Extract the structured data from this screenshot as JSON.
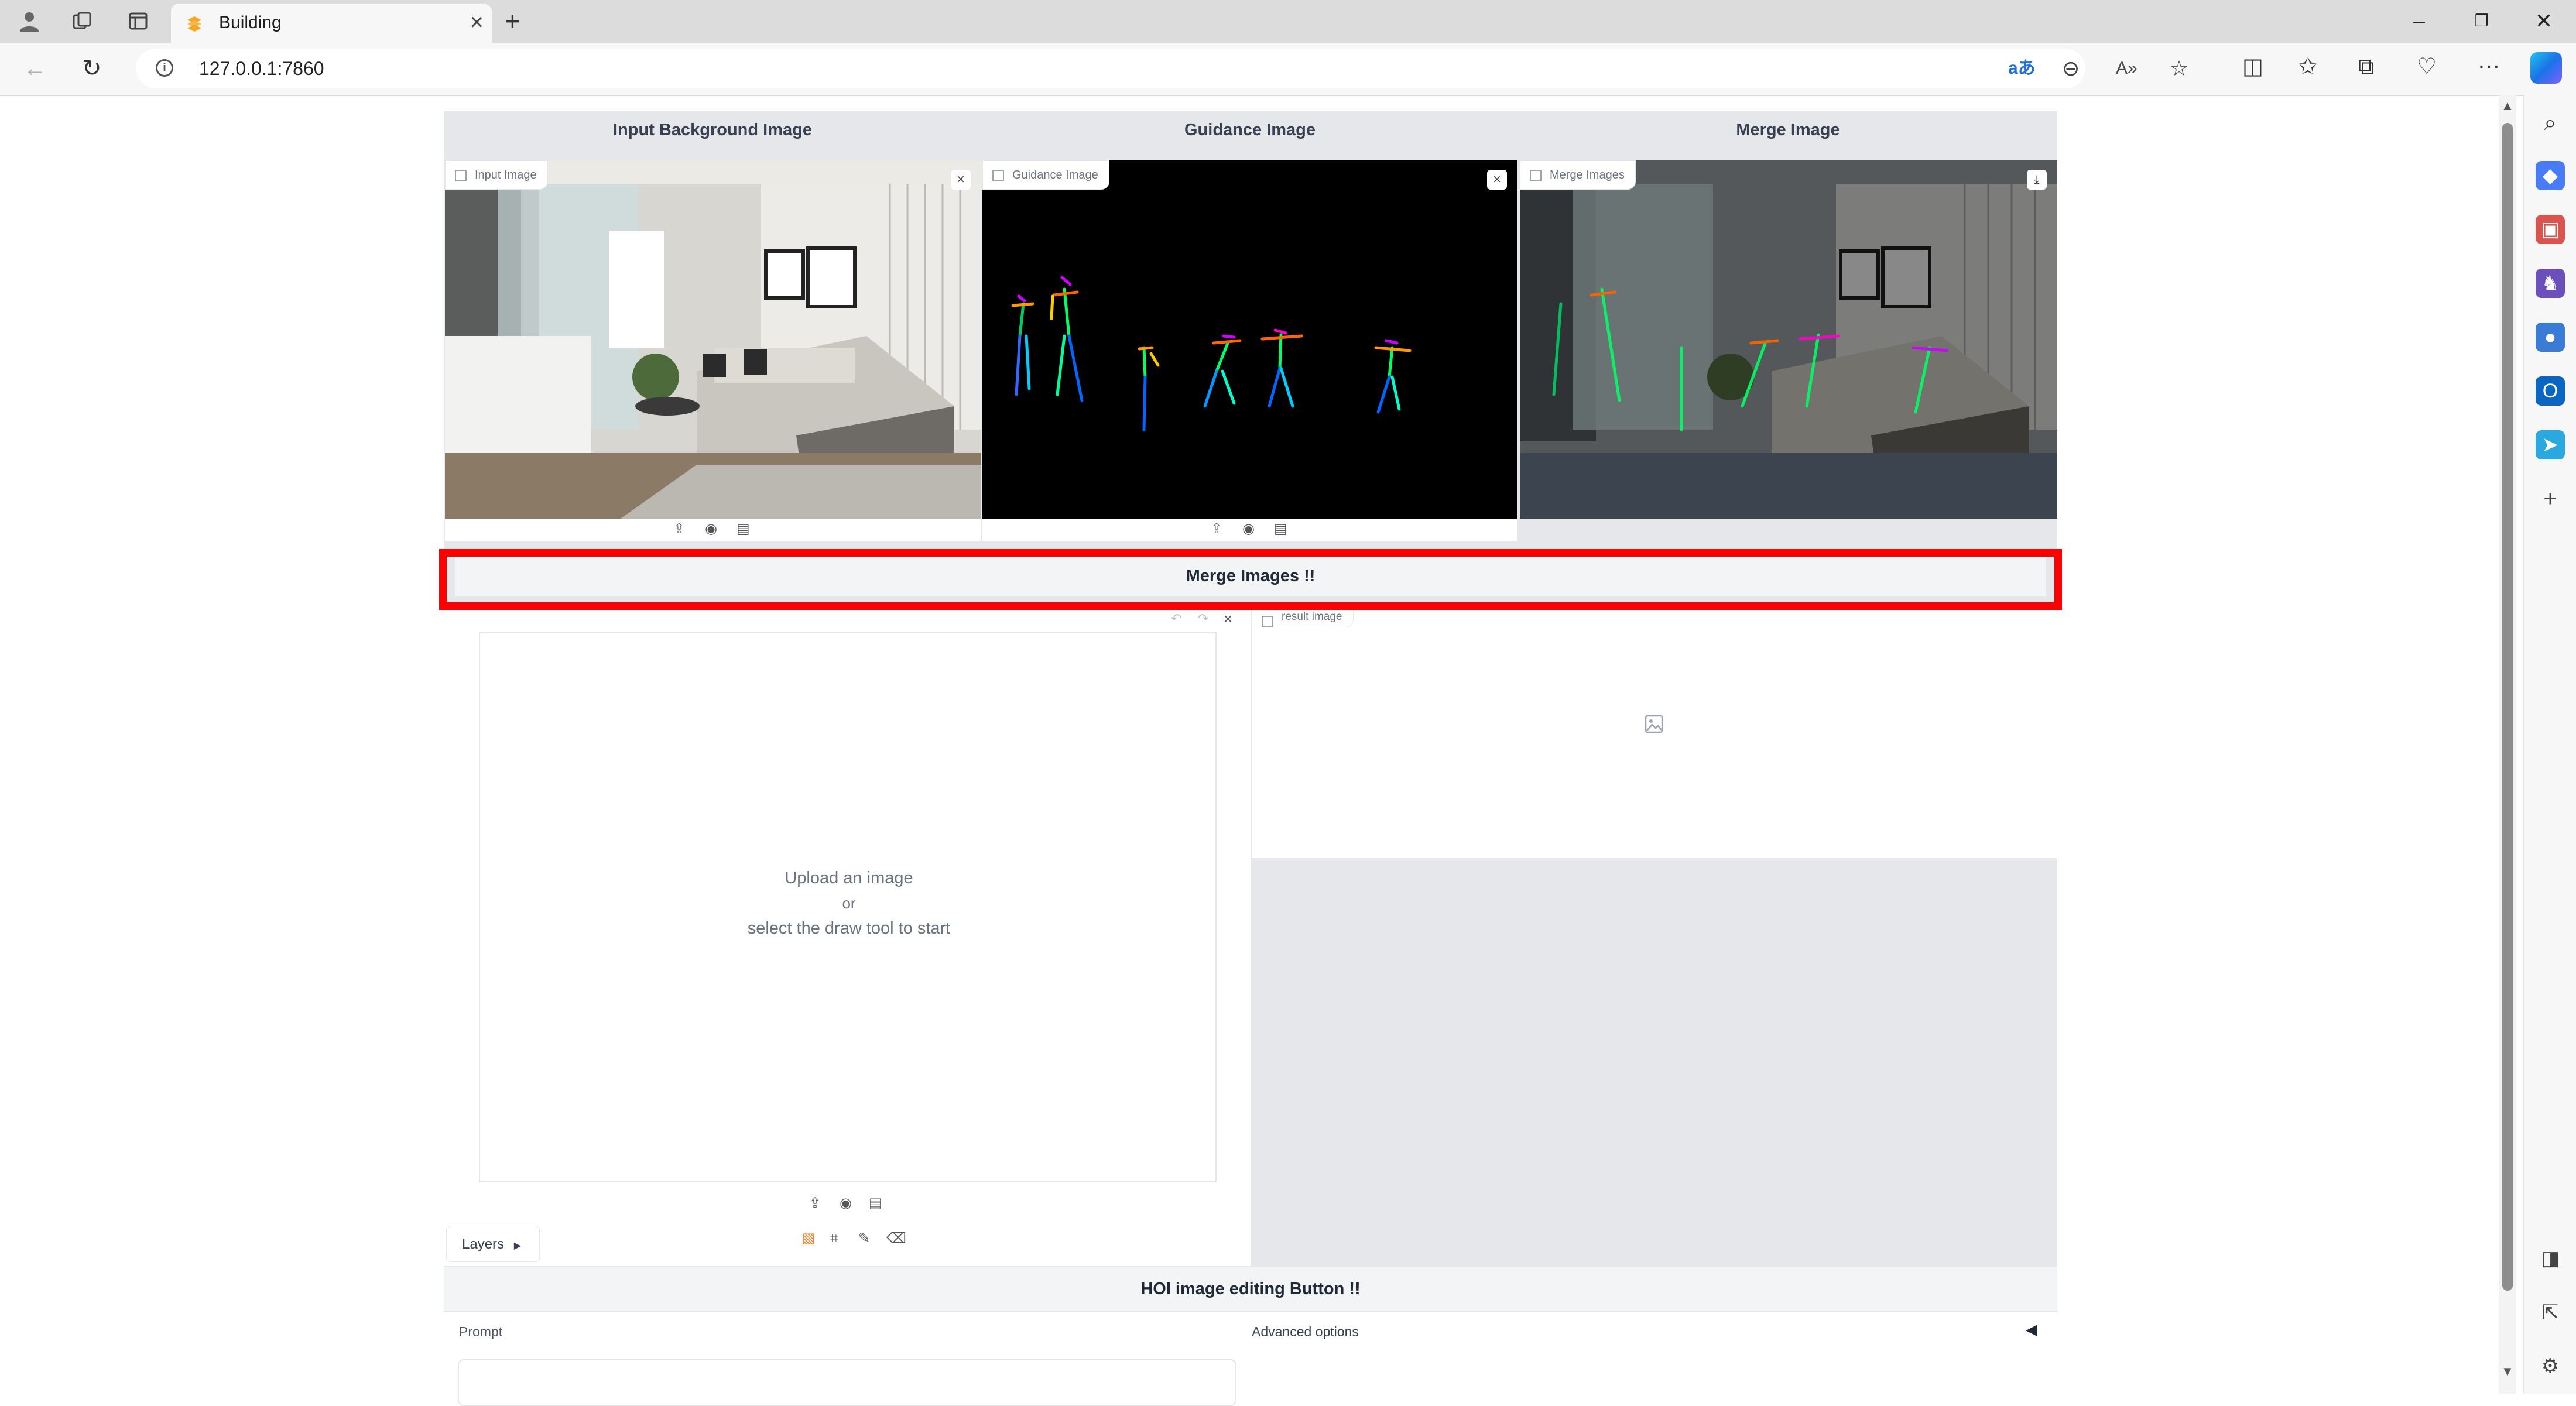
{
  "browser": {
    "tab_title": "Building",
    "url": "127.0.0.1:7860",
    "colors": {
      "copilot": "#1a73e8",
      "translate_icon": "#1f6fd6",
      "tab_favicon": "#f5a623"
    }
  },
  "app": {
    "columns": [
      {
        "header": "Input Background Image",
        "badge": "Input Image"
      },
      {
        "header": "Guidance Image",
        "badge": "Guidance Image"
      },
      {
        "header": "Merge Image",
        "badge": "Merge Images"
      }
    ],
    "merge_button": "Merge Images !!",
    "editor": {
      "line1": "Upload an image",
      "line2": "or",
      "line3": "select the draw tool to start",
      "layers_label": "Layers"
    },
    "result": {
      "badge": "result image"
    },
    "hoi_button": "HOI image editing Button !!",
    "prompt_label": "Prompt",
    "advanced_label": "Advanced options",
    "highlight_color": "#ff0000"
  }
}
